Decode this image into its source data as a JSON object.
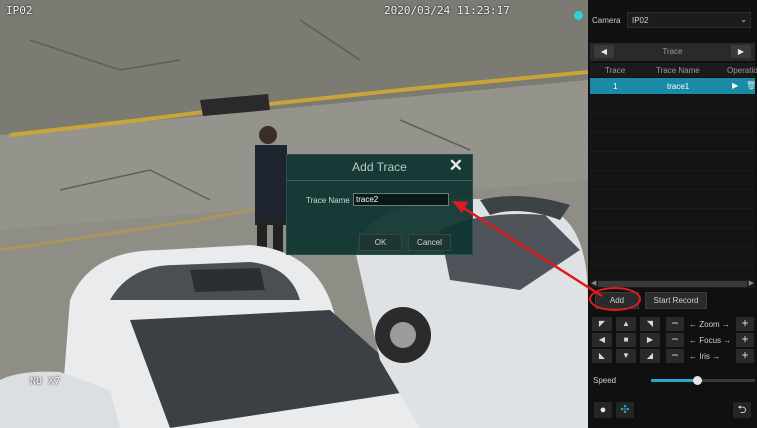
{
  "video": {
    "camera_osd": "IP02",
    "timestamp": "2020/03/24 11:23:17",
    "plate_osd": "NU X7"
  },
  "dialog": {
    "title": "Add Trace",
    "close_icon": "close-icon",
    "trace_name_label": "Trace Name",
    "trace_name_value": "trace2",
    "ok_label": "OK",
    "cancel_label": "Cancel"
  },
  "panel": {
    "camera_label": "Camera",
    "camera_value": "IP02",
    "trace_nav_title": "Trace",
    "columns": [
      "Trace",
      "Trace Name",
      "Operation"
    ],
    "rows": [
      {
        "trace": "1",
        "name": "trace1"
      }
    ],
    "add_label": "Add",
    "start_record_label": "Start Record",
    "zoom_label": "Zoom",
    "focus_label": "Focus",
    "iris_label": "Iris",
    "speed_label": "Speed",
    "speed_level": 0.44
  },
  "colors": {
    "accent": "#1a8aa7",
    "annotation": "#e01b1b",
    "dialog_bg": "#0e3430"
  }
}
